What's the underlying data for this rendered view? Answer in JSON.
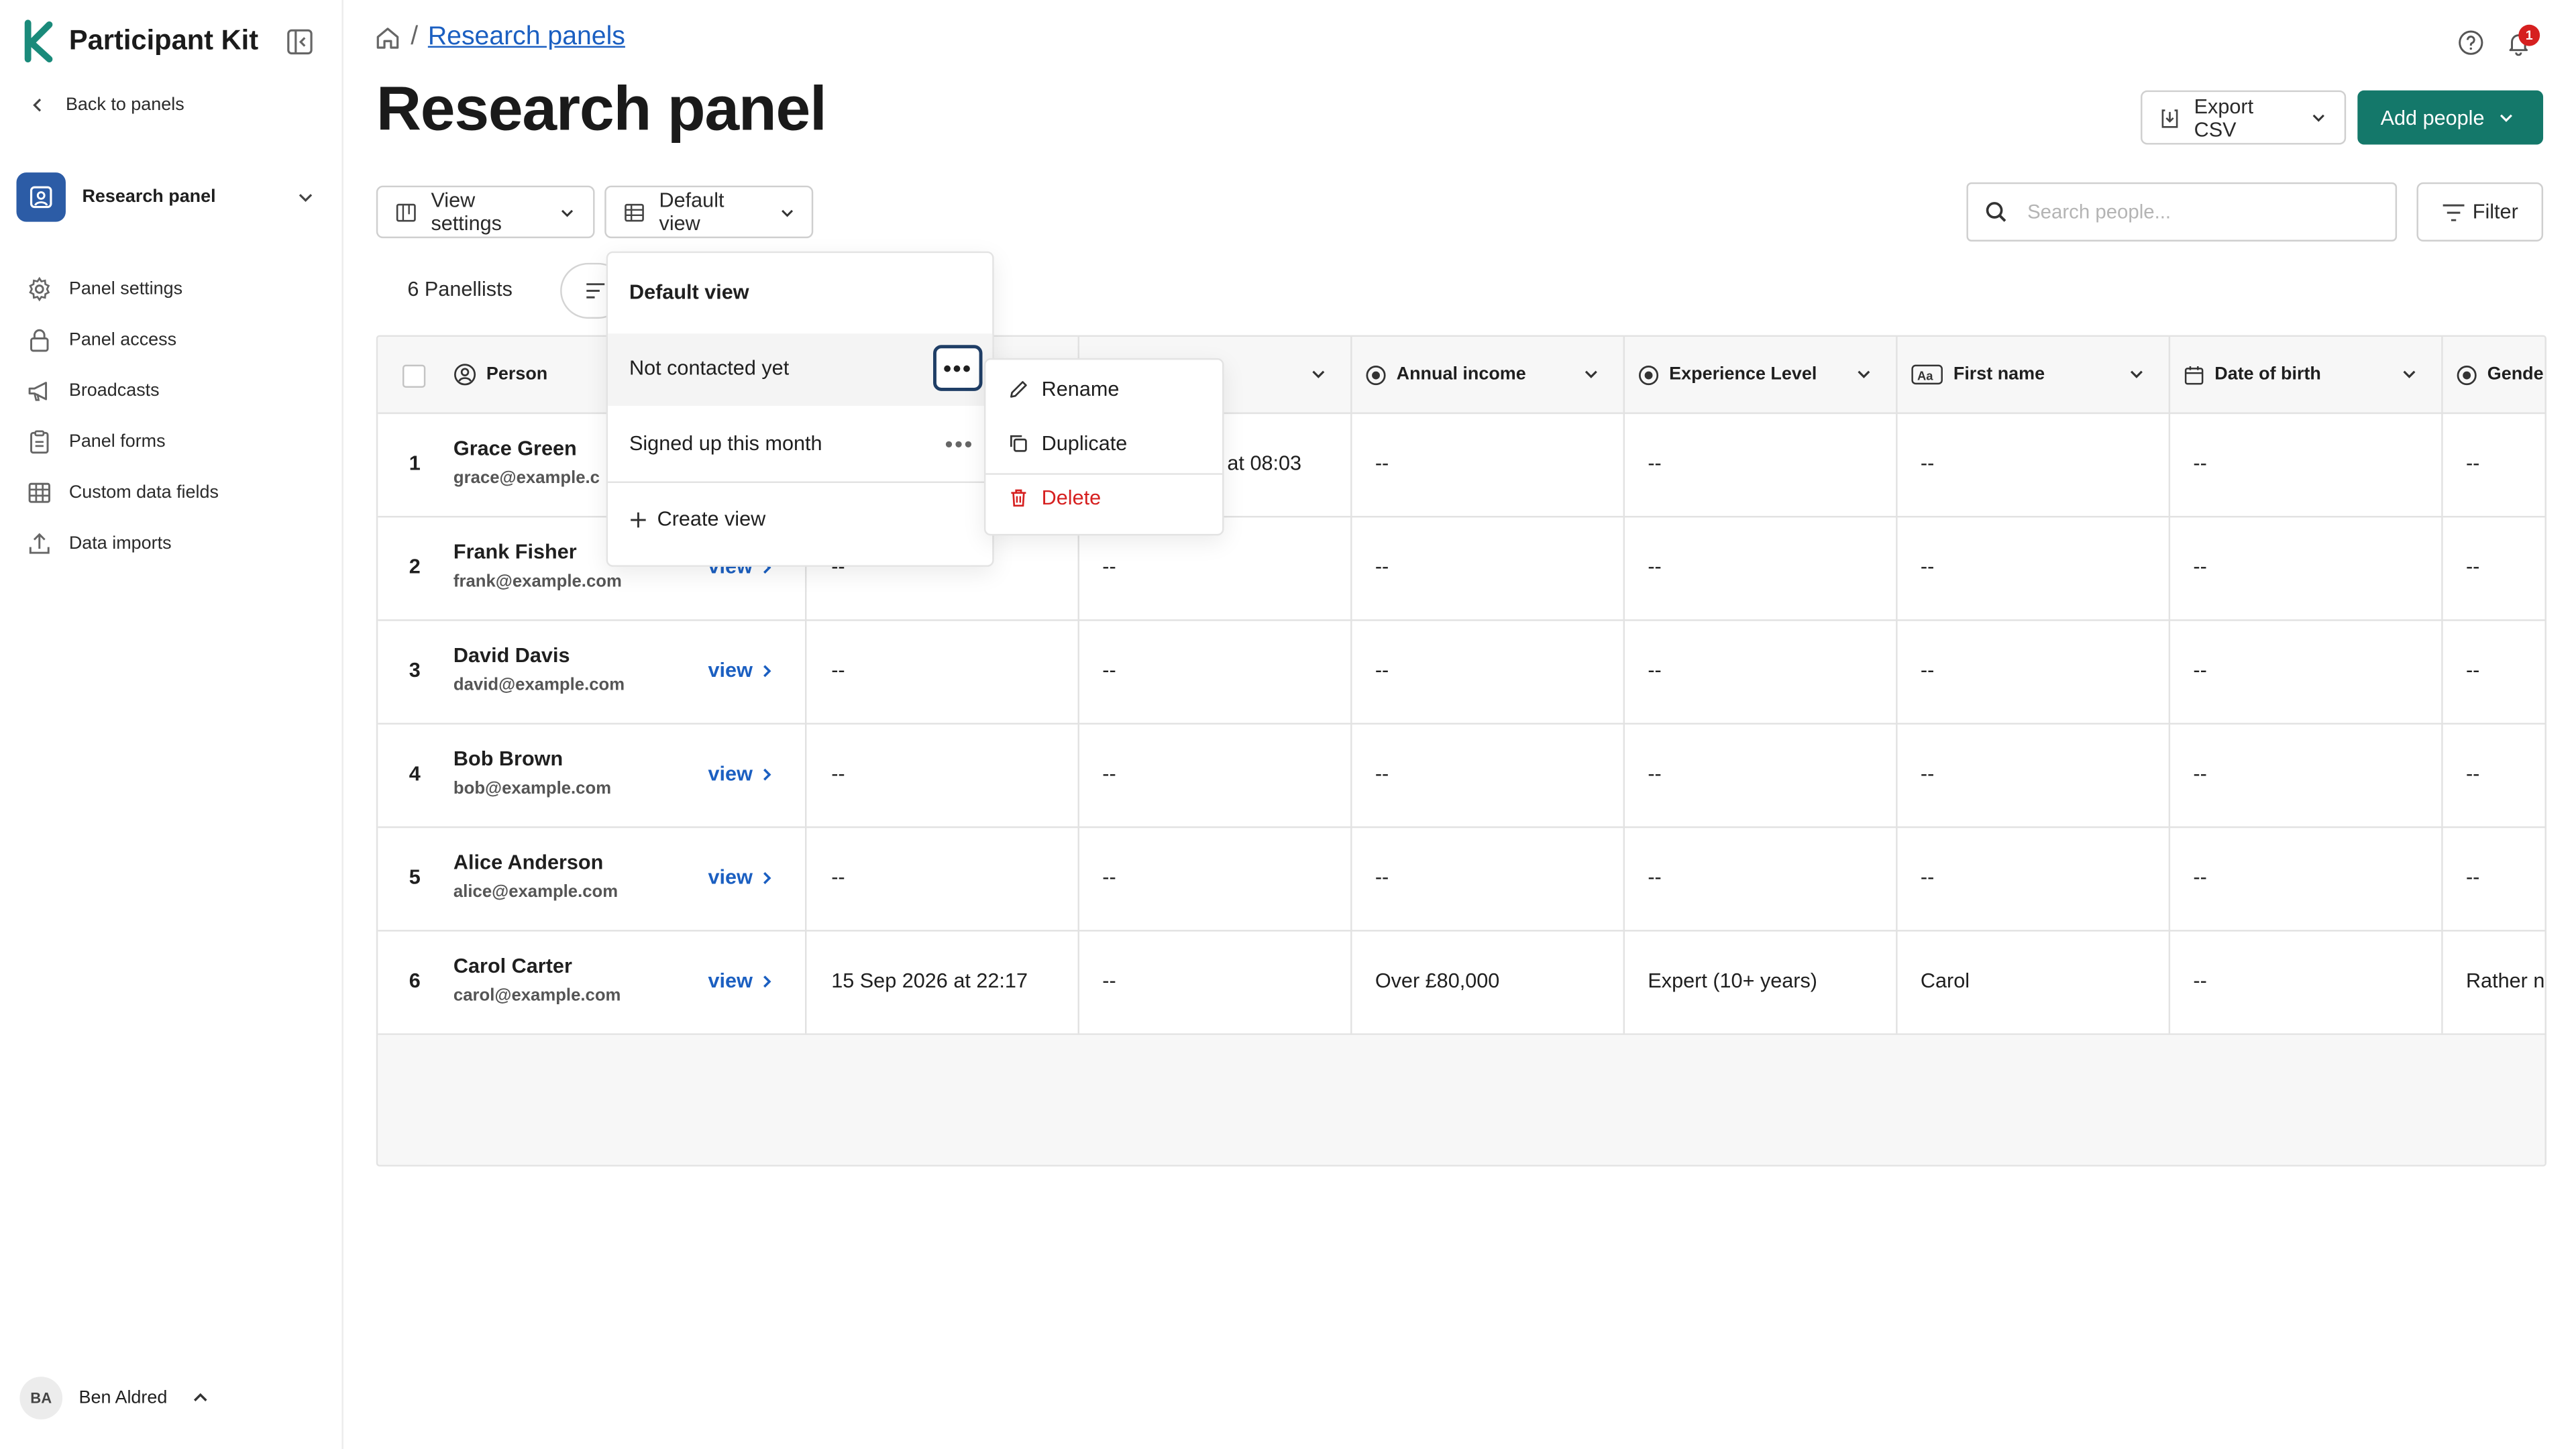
{
  "app": {
    "name": "Participant Kit",
    "accent": "#14786a",
    "link_color": "#1b5fc1"
  },
  "sidebar": {
    "back_label": "Back to panels",
    "panel_switch_label": "Research panel",
    "items": [
      {
        "label": "Panel settings",
        "icon": "gear-icon"
      },
      {
        "label": "Panel access",
        "icon": "lock-icon"
      },
      {
        "label": "Broadcasts",
        "icon": "megaphone-icon"
      },
      {
        "label": "Panel forms",
        "icon": "clipboard-icon"
      },
      {
        "label": "Custom data fields",
        "icon": "table-icon"
      },
      {
        "label": "Data imports",
        "icon": "upload-icon"
      }
    ],
    "user": {
      "initials": "BA",
      "name": "Ben Aldred"
    }
  },
  "header": {
    "breadcrumb_sep": "/",
    "breadcrumb_link": "Research panels",
    "title": "Research panel",
    "notification_count": "1",
    "export_label": "Export CSV",
    "add_label": "Add people"
  },
  "toolbar": {
    "view_settings_label": "View settings",
    "default_view_label": "Default view",
    "search_placeholder": "Search people...",
    "filter_label": "Filter",
    "count_label": "6 Panellists"
  },
  "table": {
    "columns": [
      "Person",
      "",
      "",
      "Annual income",
      "Experience Level",
      "First name",
      "Date of birth",
      "Gende"
    ],
    "view_label": "view",
    "rows": [
      {
        "num": "1",
        "name": "Grace Green",
        "email": "grace@example.c",
        "cells": [
          "",
          "at 08:03",
          "--",
          "--",
          "--",
          "--",
          "--"
        ]
      },
      {
        "num": "2",
        "name": "Frank Fisher",
        "email": "frank@example.com",
        "cells": [
          "--",
          "--",
          "--",
          "--",
          "--",
          "--",
          "--"
        ]
      },
      {
        "num": "3",
        "name": "David Davis",
        "email": "david@example.com",
        "cells": [
          "--",
          "--",
          "--",
          "--",
          "--",
          "--",
          "--"
        ]
      },
      {
        "num": "4",
        "name": "Bob Brown",
        "email": "bob@example.com",
        "cells": [
          "--",
          "--",
          "--",
          "--",
          "--",
          "--",
          "--"
        ]
      },
      {
        "num": "5",
        "name": "Alice Anderson",
        "email": "alice@example.com",
        "cells": [
          "--",
          "--",
          "--",
          "--",
          "--",
          "--",
          "--"
        ]
      },
      {
        "num": "6",
        "name": "Carol Carter",
        "email": "carol@example.com",
        "cells": [
          "15 Sep 2026 at 22:17",
          "--",
          "Over £80,000",
          "Expert (10+ years)",
          "Carol",
          "--",
          "Rather n"
        ]
      }
    ]
  },
  "dropdown": {
    "header": "Default view",
    "items": [
      "Not contacted yet",
      "Signed up this month"
    ],
    "more_glyph": "•••",
    "create_label": "Create view"
  },
  "submenu": {
    "rename": "Rename",
    "duplicate": "Duplicate",
    "delete": "Delete",
    "delete_color": "#d62020"
  }
}
